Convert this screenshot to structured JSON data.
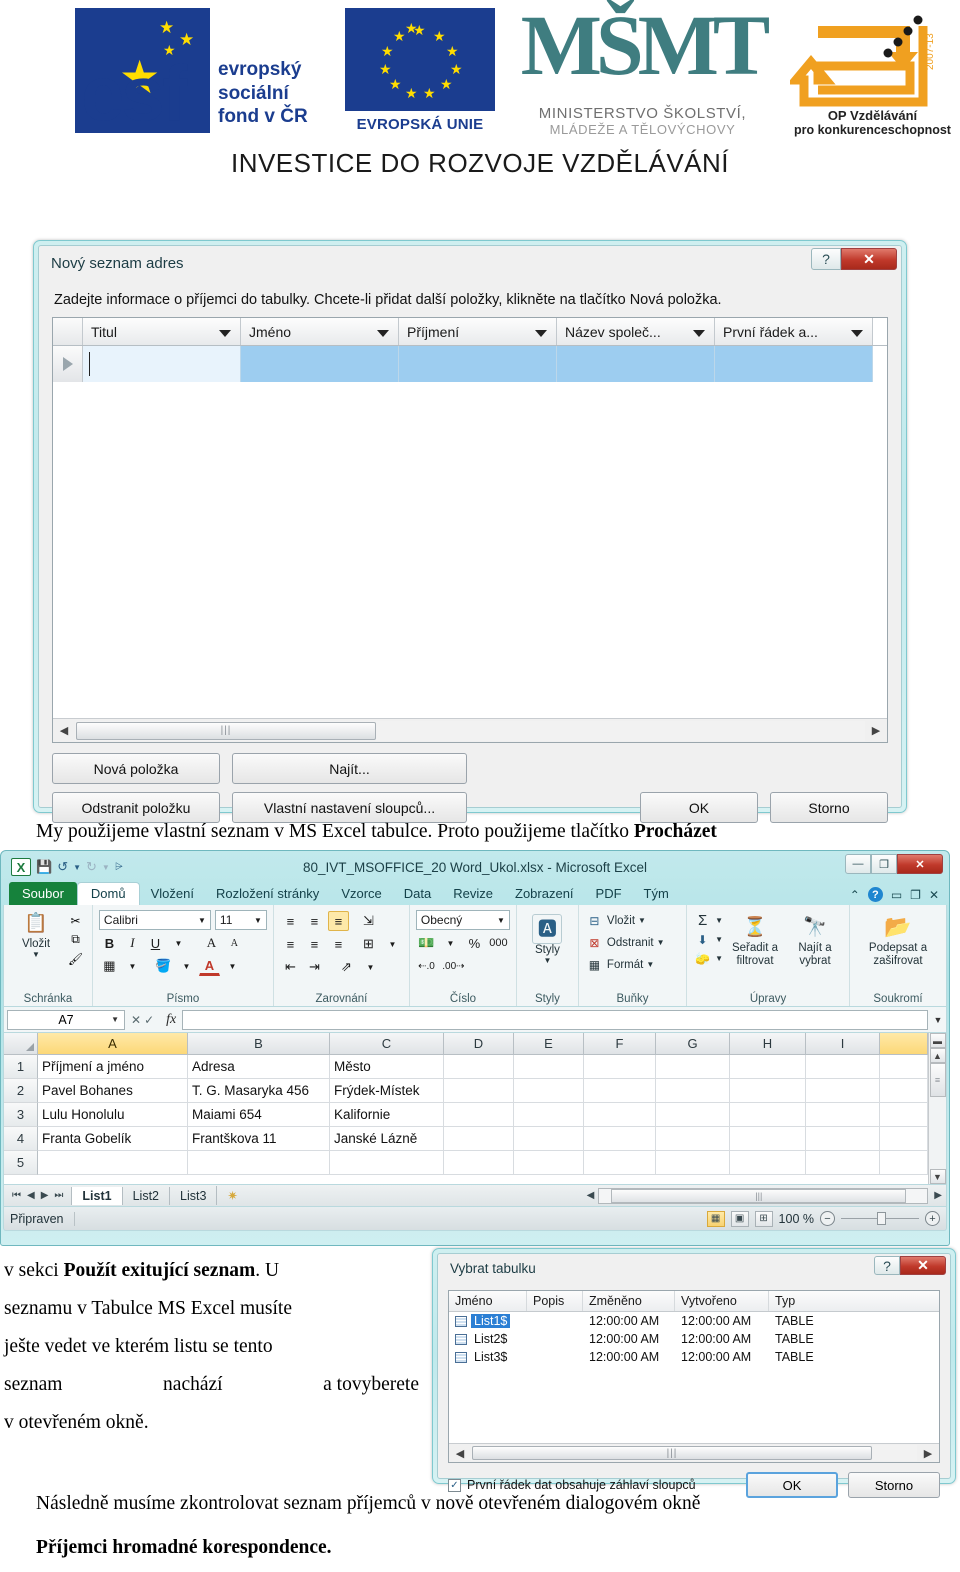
{
  "header": {
    "esf": {
      "line1": "evropský",
      "line2": "sociální",
      "line3": "fond v ČR",
      "mark": "esf"
    },
    "eu": {
      "caption": "EVROPSKÁ UNIE"
    },
    "msmt": {
      "glyph": "MŠMT",
      "line1": "MINISTERSTVO ŠKOLSTVÍ,",
      "line2": "MLÁDEŽE A TĚLOVÝCHOVY"
    },
    "op": {
      "line1": "OP Vzdělávání",
      "line2": "pro konkurenceschopnost",
      "years": "2007-13"
    },
    "investice": "INVESTICE DO ROZVOJE VZDĚLÁVÁNÍ"
  },
  "new_list_dialog": {
    "title": "Nový seznam adres",
    "help_icon": "?",
    "close_icon": "✕",
    "instruction": "Zadejte informace o příjemci do tabulky. Chcete-li přidat další položky, klikněte na tlačítko Nová položka.",
    "instruction_accel": "Z",
    "columns": [
      "Titul",
      "Jméno",
      "Příjmení",
      "Název společ...",
      "První řádek a..."
    ],
    "row_marker": "▶",
    "buttons": {
      "new_item": "Nová položka",
      "find": "Najít...",
      "remove_item": "Odstranit položku",
      "custom_columns": "Vlastní nastavení sloupců...",
      "ok": "OK",
      "cancel": "Storno"
    },
    "scroll_left": "◀",
    "scroll_right": "▶",
    "thumb_grip": "|||"
  },
  "caption1": {
    "text_before": "My použijeme vlastní seznam v MS Excel tabulce. Proto použijeme tlačítko ",
    "bold": "Procházet"
  },
  "excel": {
    "doc_title": "80_IVT_MSOFFICE_20 Word_Ukol.xlsx - Microsoft Excel",
    "app_logo": "X",
    "qat": [
      "save-icon",
      "undo-icon",
      "redo-icon",
      "customize-icon"
    ],
    "window_buttons": {
      "minimize": "—",
      "restore": "❐",
      "close": "✕"
    },
    "ribbon_tabs": [
      "Soubor",
      "Domů",
      "Vloženi",
      "Rozložení stránky",
      "Vzorce",
      "Data",
      "Revize",
      "Zobrazení",
      "PDF",
      "Tým"
    ],
    "ribbon_tabs_fixed": [
      "Soubor",
      "Domů",
      "Vložení",
      "Rozložení stránky",
      "Vzorce",
      "Data",
      "Revize",
      "Zobrazení",
      "PDF",
      "Tým"
    ],
    "active_tab": "Domů",
    "ribbon_right_icons": [
      "collapse-ribbon-icon",
      "help-icon",
      "minimize-icon",
      "restore-icon",
      "close-icon"
    ],
    "groups": {
      "clipboard": {
        "label": "Schránka",
        "paste": "Vložit",
        "cut": "✂",
        "copy": "⧉",
        "format_painter": "🖌"
      },
      "font": {
        "label": "Písmo",
        "font_name": "Calibri",
        "font_size": "11",
        "bold": "B",
        "italic": "I",
        "underline": "U",
        "grow": "A",
        "shrink": "A",
        "borders": "▦",
        "fill": "🅰",
        "color": "A"
      },
      "alignment": {
        "label": "Zarovnání",
        "top": "≡",
        "middle": "≡",
        "bottom": "≡",
        "wrap": "↵",
        "left": "≡",
        "center": "≡",
        "right": "≡",
        "merge": "⊞",
        "indent_dec": "⇤",
        "indent_inc": "⇥",
        "orientation": "⇗"
      },
      "number": {
        "label": "Číslo",
        "format": "Obecný",
        "currency": "💰",
        "percent": "%",
        "thousands": "000",
        "inc_dec": "←,0",
        "dec_dec": ",00"
      },
      "styles": {
        "label": "Styly",
        "name": "Styly"
      },
      "cells": {
        "label": "Buňky",
        "insert": "Vložit",
        "delete": "Odstranit",
        "format": "Formát"
      },
      "editing": {
        "label": "Úpravy",
        "sum": "Σ",
        "fill": "↓",
        "clear": "◻",
        "sort_filter": "Seřadit a filtrovat",
        "find_select": "Najít a vybrat"
      },
      "privacy": {
        "label": "Soukromí",
        "sign_encrypt": "Podepsat a zašifrovat"
      }
    },
    "name_box": "A7",
    "formula_icons": {
      "cancel": "✕",
      "accept": "✓",
      "fx": "fx"
    },
    "columns": [
      "A",
      "B",
      "C",
      "D",
      "E",
      "F",
      "G",
      "H",
      "I"
    ],
    "selected_column": "A",
    "rows": [
      "1",
      "2",
      "3",
      "4",
      "5"
    ],
    "cells": [
      [
        "Příjmení a jméno",
        "Adresa",
        "Město",
        "",
        "",
        "",
        "",
        "",
        ""
      ],
      [
        "Pavel Bohanes",
        "T. G. Masaryka 456",
        "Frýdek-Místek",
        "",
        "",
        "",
        "",
        "",
        ""
      ],
      [
        "Lulu Honolulu",
        "Maiami 654",
        "Kalifornie",
        "",
        "",
        "",
        "",
        "",
        ""
      ],
      [
        "Franta Gobelík",
        "Frantškova 11",
        "Janské Lázně",
        "",
        "",
        "",
        "",
        "",
        ""
      ],
      [
        "",
        "",
        "",
        "",
        "",
        "",
        "",
        "",
        ""
      ]
    ],
    "sheet_tabs": [
      "List1",
      "List2",
      "List3"
    ],
    "active_sheet": "List1",
    "new_sheet_icon": "✷",
    "nav_buttons": [
      "⏮",
      "◀",
      "▶",
      "⏭"
    ],
    "status": "Připraven",
    "zoom": "100 %",
    "zoom_out": "−",
    "zoom_in": "+",
    "view_buttons": [
      "normal-view-icon",
      "page-layout-icon",
      "page-break-icon"
    ]
  },
  "caption2": {
    "lines": [
      [
        "v sekci ",
        "Použít  exitující  seznam",
        ".  U"
      ],
      [
        "seznamu v Tabulce MS Excel musíte"
      ],
      [
        "ješte vedet ve kterém listu se tento"
      ],
      [
        "seznam",
        "nachází",
        "a tovyberete"
      ],
      [
        "v otevřeném okně."
      ]
    ],
    "l1a": "v sekci ",
    "l1b": "Použít  exitující  seznam",
    "l1c": ".   U",
    "l2": "seznamu  v Tabulce  MS  Excel  musíte",
    "l3": "ješte  vedet  ve  kterém  listu  se  tento",
    "l4a": "seznam",
    "l4b": "nachází",
    "l4c": "a tovyberete",
    "l5": "v otevřeném okně."
  },
  "select_table_dialog": {
    "title": "Vybrat tabulku",
    "help_icon": "?",
    "close_icon": "✕",
    "columns": [
      "Jméno",
      "Popis",
      "Změněno",
      "Vytvořeno",
      "Typ"
    ],
    "rows": [
      {
        "name": "List1$",
        "description": "",
        "modified": "12:00:00 AM",
        "created": "12:00:00 AM",
        "type": "TABLE",
        "selected": true
      },
      {
        "name": "List2$",
        "description": "",
        "modified": "12:00:00 AM",
        "created": "12:00:00 AM",
        "type": "TABLE",
        "selected": false
      },
      {
        "name": "List3$",
        "description": "",
        "modified": "12:00:00 AM",
        "created": "12:00:00 AM",
        "type": "TABLE",
        "selected": false
      }
    ],
    "checkbox_label": "První řádek dat obsahuje záhlaví sloupců",
    "checkbox_accel": "P",
    "checkbox_checked": "✓",
    "ok": "OK",
    "cancel": "Storno",
    "scroll_left": "◀",
    "scroll_right": "▶",
    "thumb_grip": "|||"
  },
  "caption3": {
    "line1": "Následně  musíme  zkontrolovat  seznam  příjemců  v nově  otevřeném  dialogovém  okně",
    "line2": "Příjemci hromadné korespondence."
  }
}
